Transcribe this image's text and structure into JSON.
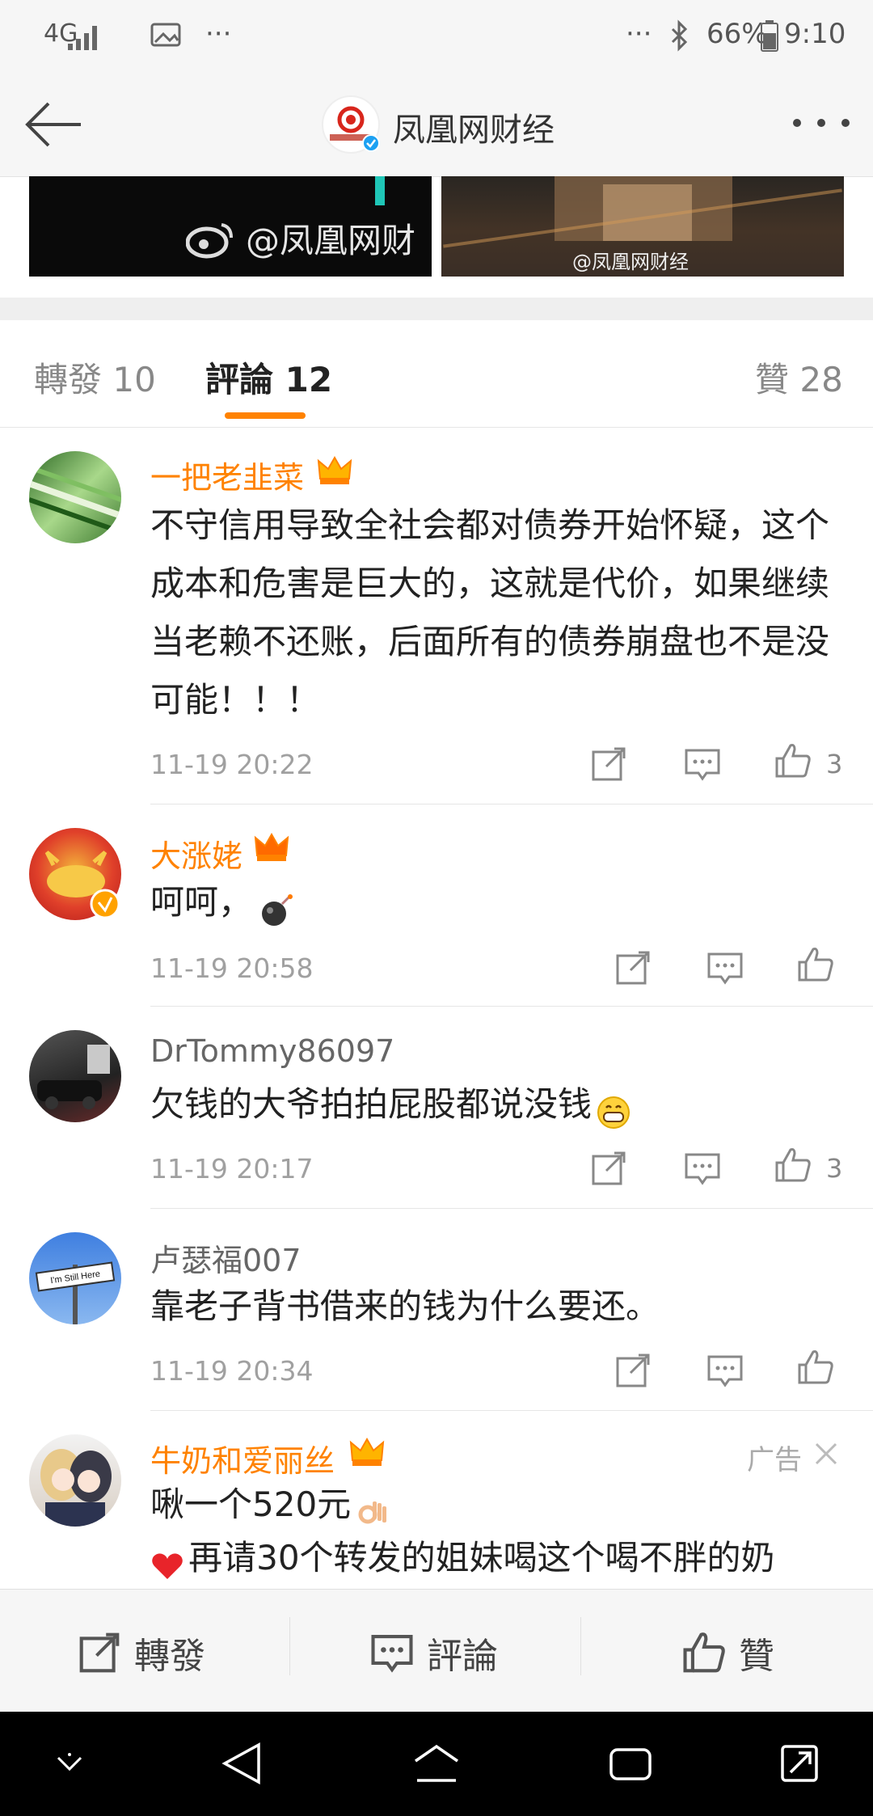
{
  "statusbar": {
    "network": "4G",
    "battery": "66%",
    "time": "9:10",
    "dots_left": "···",
    "dots_right": "···"
  },
  "header": {
    "title": "凤凰网财经",
    "logo_text": "凤凰网财经"
  },
  "media": {
    "left_caption": "@凤凰网财",
    "right_caption": "@凤凰网财经"
  },
  "tabs": [
    {
      "label": "轉發 10"
    },
    {
      "label": "評論 12"
    },
    {
      "label": "贊 28"
    }
  ],
  "comments": [
    {
      "user": "一把老韭菜",
      "text": "不守信用导致全社会都对债券开始怀疑，这个成本和危害是巨大的，这就是代价，如果继续当老赖不还账，后面所有的债券崩盘也不是没可能！！！",
      "time": "11-19 20:22",
      "likes": "3"
    },
    {
      "user": "大涨姥",
      "text": "呵呵，",
      "time": "11-19 20:58",
      "likes": ""
    },
    {
      "user": "DrTommy86097",
      "text": "欠钱的大爷拍拍屁股都说没钱",
      "time": "11-19 20:17",
      "likes": "3"
    },
    {
      "user": "卢瑟福007",
      "text": "靠老子背书借来的钱为什么要还。",
      "time": "11-19 20:34",
      "likes": ""
    },
    {
      "user": "牛奶和爱丽丝",
      "text": "啾一个520元",
      "text2": "再请30个转发的姐妹喝这个喝不胖的奶",
      "ad_label": "广告"
    }
  ],
  "avatar4_sign": "I'm Still Here",
  "toolbar": {
    "repost": "轉發",
    "comment": "評論",
    "like": "贊"
  },
  "colors": {
    "accent": "#ff8200",
    "vip_name": "#ff8200",
    "time": "#a0a0a0"
  }
}
